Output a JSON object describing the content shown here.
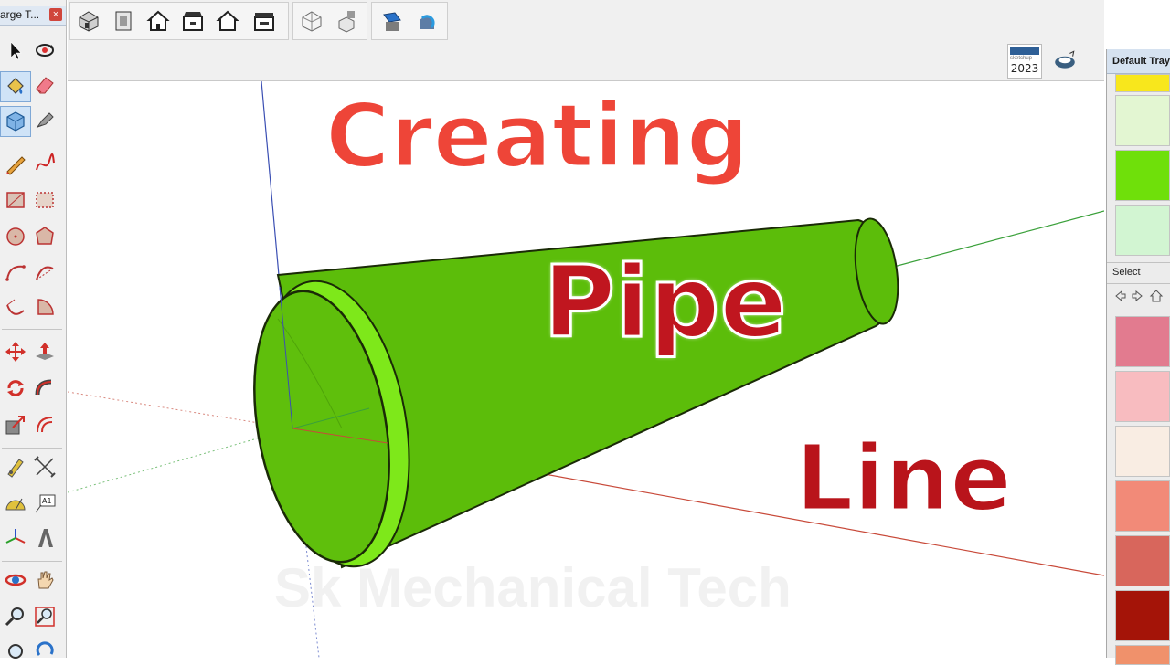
{
  "left_toolbar": {
    "title": "arge T...",
    "close_label": "×",
    "tools": [
      "select-tool-icon",
      "orbit-tool-icon",
      "paint-bucket-icon",
      "eraser-icon",
      "make-component-icon",
      "tape-measure-icon",
      "pencil-line-icon",
      "freehand-icon",
      "rectangle-icon",
      "rotated-rectangle-icon",
      "circle-icon",
      "polygon-icon",
      "arc-icon",
      "two-point-arc-icon",
      "three-point-arc-icon",
      "pie-icon",
      "move-icon",
      "push-pull-icon",
      "rotate-icon",
      "follow-me-icon",
      "scale-icon",
      "offset-icon",
      "tape-measure-tool-icon",
      "dimension-icon",
      "protractor-icon",
      "text-icon",
      "axes-icon",
      "3d-text-icon",
      "orbit-nav-icon",
      "pan-icon",
      "zoom-icon",
      "zoom-window-icon",
      "zoom-extents-icon",
      "previous-view-icon"
    ]
  },
  "top_toolbar": {
    "view_buttons": [
      "iso-view-icon",
      "top-view-icon",
      "front-view-icon",
      "right-view-icon",
      "back-view-icon",
      "left-view-icon"
    ],
    "style_buttons": [
      "xray-icon",
      "back-edges-icon"
    ],
    "other_buttons": [
      "section-plane-icon",
      "3d-warehouse-icon"
    ],
    "version_badge": "2023",
    "extension_icon": "extension-warehouse-icon"
  },
  "tray": {
    "title": "Default Tray",
    "select_label": "Select",
    "nav_icons": [
      "back-arrow-icon",
      "forward-arrow-icon",
      "home-icon"
    ],
    "colors_top": [
      "#f8e71c",
      "#e3f6d2",
      "#6fe00a",
      "#d2f5d2"
    ],
    "colors_bottom": [
      "#e27b8f",
      "#f8bcc0",
      "#f9ede3",
      "#f28a78",
      "#d8665c",
      "#a41408",
      "#f0916b"
    ]
  },
  "viewport": {
    "title_line1": "Creating",
    "title_line2": "Pipe",
    "title_line3": "Line",
    "watermark": "Sk Mechanical Tech",
    "pipe_color": "#5cbd0a",
    "title_color_1": "#ee4538",
    "title_color_2": "#c0161f"
  }
}
